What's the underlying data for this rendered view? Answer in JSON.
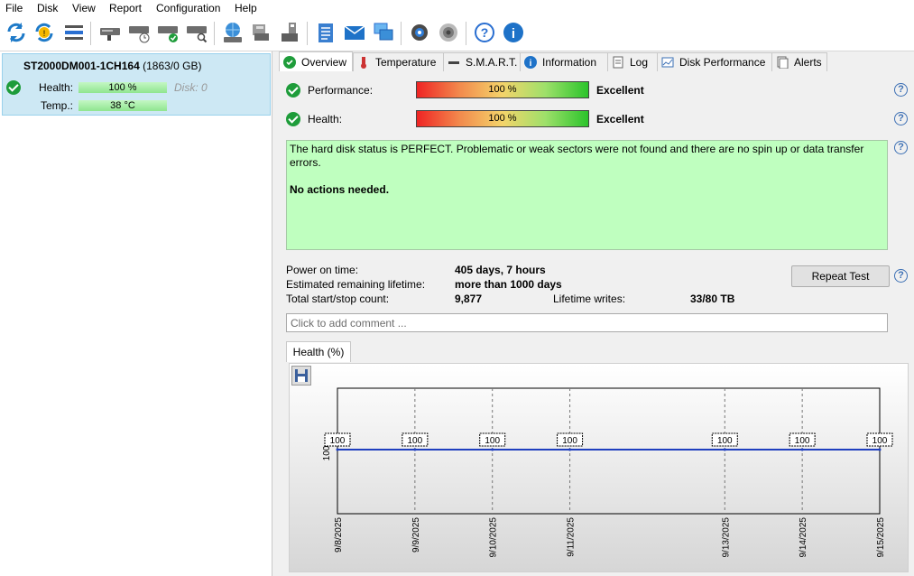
{
  "menu": [
    "File",
    "Disk",
    "View",
    "Report",
    "Configuration",
    "Help"
  ],
  "toolbar_icons": [
    "refresh-icon",
    "refresh-all-icon",
    "status-icon",
    "drive-icon",
    "drive-clock-icon",
    "drive-check-icon",
    "drive-search-icon",
    "network-drive-icon",
    "printer-drive-icon",
    "usb-drive-icon",
    "notepad-icon",
    "mail-icon",
    "remote-icon",
    "settings-gear-icon",
    "speaker-icon",
    "help-icon",
    "info-icon"
  ],
  "disk": {
    "model": "ST2000DM001-1CH164",
    "capacity": "(1863/0 GB)",
    "health_label": "Health:",
    "health_value": "100 %",
    "disk_index": "Disk: 0",
    "temp_label": "Temp.:",
    "temp_value": "38 °C"
  },
  "tabs": [
    "Overview",
    "Temperature",
    "S.M.A.R.T.",
    "Information",
    "Log",
    "Disk Performance",
    "Alerts"
  ],
  "overview": {
    "performance_label": "Performance:",
    "performance_value": "100 %",
    "performance_rating": "Excellent",
    "health_label": "Health:",
    "health_value": "100 %",
    "health_rating": "Excellent",
    "status_text": "The hard disk status is PERFECT. Problematic or weak sectors were not found and there are no spin up or data transfer errors.",
    "actions_text": "No actions needed.",
    "power_on_label": "Power on time:",
    "power_on_value": "405 days, 7 hours",
    "lifetime_label": "Estimated remaining lifetime:",
    "lifetime_value": "more than 1000 days",
    "startstop_label": "Total start/stop count:",
    "startstop_value": "9,877",
    "writes_label": "Lifetime writes:",
    "writes_value": "33/80 TB",
    "repeat_button": "Repeat Test",
    "comment_placeholder": "Click to add comment ...",
    "chart_tab": "Health (%)"
  },
  "chart_data": {
    "type": "line",
    "title": "",
    "xlabel": "",
    "ylabel": "",
    "categories": [
      "9/8/2025",
      "9/9/2025",
      "9/10/2025",
      "9/11/2025",
      "9/13/2025",
      "9/14/2025",
      "9/15/2025"
    ],
    "series": [
      {
        "values": [
          100,
          100,
          100,
          100,
          100,
          100,
          100
        ]
      }
    ],
    "ytick": "100",
    "line_color": "#1f3fbf",
    "grid": true
  }
}
